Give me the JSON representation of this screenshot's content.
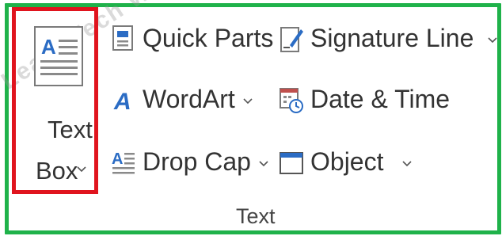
{
  "ribbon_group": {
    "name": "Text",
    "text_box": {
      "line1": "Text",
      "line2": "Box"
    },
    "items": {
      "quick_parts": "Quick Parts",
      "wordart": "WordArt",
      "drop_cap": "Drop Cap",
      "signature_line": "Signature Line",
      "date_time": "Date & Time",
      "object": "Object"
    }
  },
  "watermark": "Learn Tech W",
  "colors": {
    "group_outline": "#1fb24a",
    "highlight": "#e0141e",
    "icon_blue": "#2b6cc4"
  }
}
